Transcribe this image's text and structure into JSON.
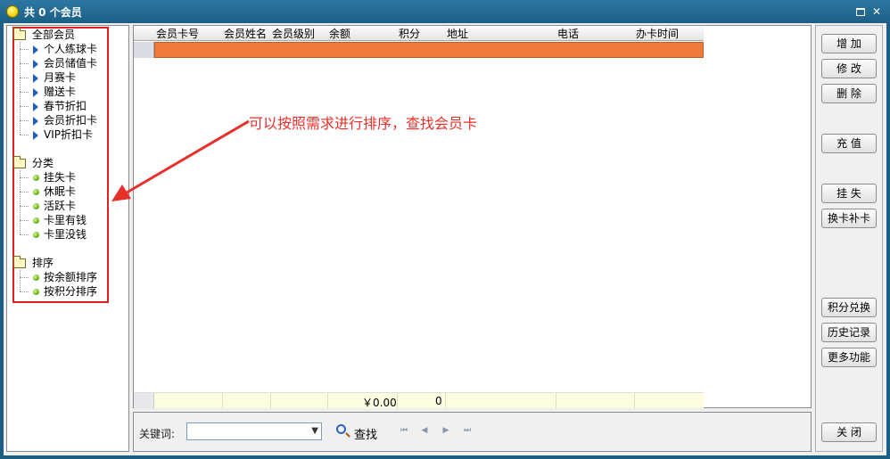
{
  "window": {
    "title": "共 0 个会员"
  },
  "tree": {
    "groups": [
      {
        "label": "全部会员",
        "items": [
          "个人练球卡",
          "会员储值卡",
          "月赛卡",
          "赠送卡",
          "春节折扣",
          "会员折扣卡",
          "VIP折扣卡"
        ]
      },
      {
        "label": "分类",
        "items": [
          "挂失卡",
          "休眠卡",
          "活跃卡",
          "卡里有钱",
          "卡里没钱"
        ]
      },
      {
        "label": "排序",
        "items": [
          "按余额排序",
          "按积分排序"
        ]
      }
    ]
  },
  "grid": {
    "columns": [
      "会员卡号",
      "会员姓名",
      "会员级别",
      "余额",
      "积分",
      "地址",
      "电话",
      "办卡时间"
    ],
    "footer": {
      "balance_total": "￥0.00",
      "points_total": "0"
    }
  },
  "annotation": "可以按照需求进行排序，查找会员卡",
  "search": {
    "label": "关键词:",
    "value": "",
    "button": "查找"
  },
  "actions": [
    "增 加",
    "修 改",
    "删 除",
    "充 值",
    "挂 失",
    "换卡补卡",
    "积分兑换",
    "历史记录",
    "更多功能",
    "关 闭"
  ],
  "colors": {
    "title_bar": "#1c5e85",
    "selected_row": "#f07a3c",
    "highlight": "#e02020",
    "annotation_text": "#e8302a"
  }
}
